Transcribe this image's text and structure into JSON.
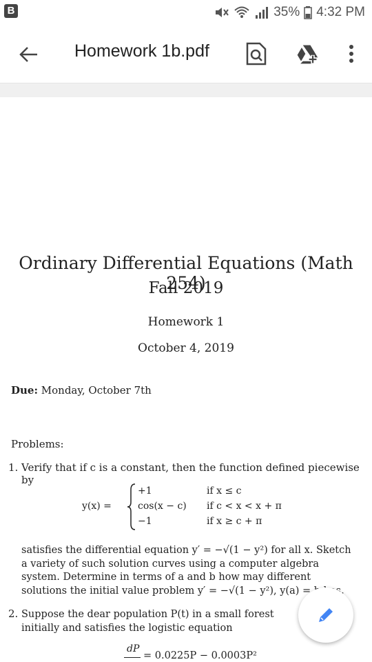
{
  "status_bar": {
    "badge": "B",
    "battery": "35%",
    "time": "4:32 PM"
  },
  "toolbar": {
    "title": "Homework 1b.pdf"
  },
  "document": {
    "course_title": "Ordinary Differential Equations (Math 254)",
    "term": "Fall 2019",
    "homework": "Homework 1",
    "date": "October 4, 2019",
    "due_label": "Due:",
    "due_value": "Monday, October 7th",
    "problems_label": "Problems:",
    "p1": {
      "number": "1.",
      "intro": "Verify that if c is a constant, then the function defined piecewise by",
      "lhs": "y(x) =",
      "cases": [
        "+1",
        "cos(x − c)",
        "−1"
      ],
      "conditions": [
        "if x ≤ c",
        "if c < x < x + π",
        "if x ≥ c + π"
      ],
      "para": "satisfies the differential equation y′ = −√(1 − y²) for all x. Sketch a variety of such solution curves using a computer algebra system. Determine in terms of a and b how may different solutions the initial value problem y′ = −√(1 − y²), y(a) = b has."
    },
    "p2": {
      "number": "2.",
      "para": "Suppose the dear population P(t) in a small forest initially and satisfies the logistic equation",
      "frac_num": "dP",
      "rhs": "= 0.0225P − 0.0003P²"
    }
  }
}
